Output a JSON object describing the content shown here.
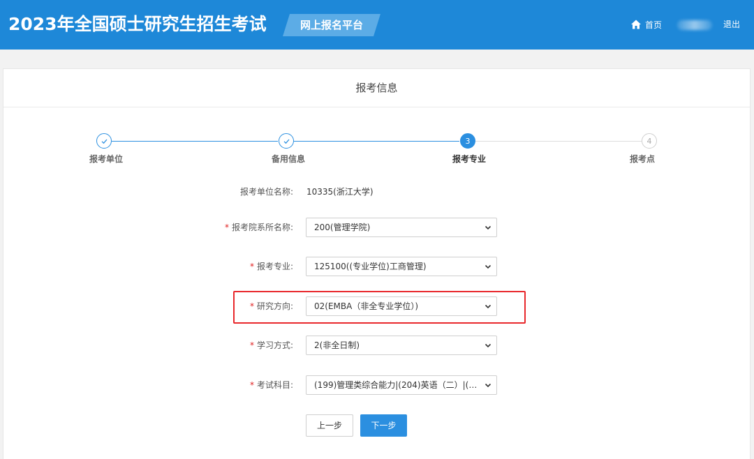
{
  "header": {
    "site_title": "2023年全国硕士研究生招生考试",
    "platform_name": "网上报名平台",
    "home_label": "首页",
    "logout_label": "退出",
    "brand_color": "#1e88d8"
  },
  "card": {
    "title": "报考信息"
  },
  "steps": [
    {
      "number": "1",
      "label": "报考单位",
      "status": "done"
    },
    {
      "number": "2",
      "label": "备用信息",
      "status": "done"
    },
    {
      "number": "3",
      "label": "报考专业",
      "status": "active"
    },
    {
      "number": "4",
      "label": "报考点",
      "status": "todo"
    }
  ],
  "form": {
    "unit_label": "报考单位名称:",
    "unit_value": "10335(浙江大学)",
    "required_mark": "*",
    "department_label": "报考院系所名称:",
    "department_value": "200(管理学院)",
    "major_label": "报考专业:",
    "major_value": "125100((专业学位)工商管理)",
    "direction_label": "研究方向:",
    "direction_value": "02(EMBA（非全专业学位）)",
    "study_mode_label": "学习方式:",
    "study_mode_value": "2(非全日制)",
    "subjects_label": "考试科目:",
    "subjects_value": "(199)管理类综合能力|(204)英语（二）|(-..."
  },
  "buttons": {
    "prev_label": "上一步",
    "next_label": "下一步"
  },
  "colors": {
    "accent": "#2b8fe0",
    "highlight": "#e8272b",
    "required": "#e02020"
  }
}
